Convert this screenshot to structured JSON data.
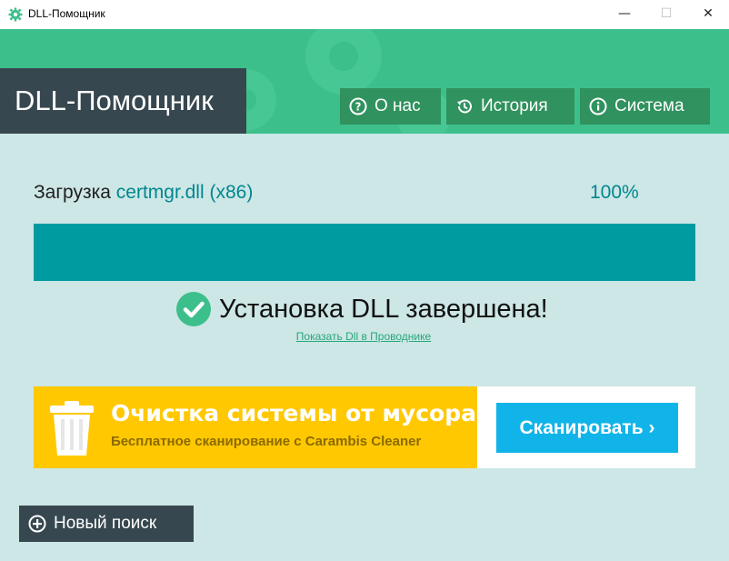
{
  "window": {
    "title": "DLL-Помощник",
    "minimize_glyph": "—",
    "maximize_glyph": "☐",
    "close_glyph": "✕"
  },
  "header": {
    "logo": "DLL-Помощник",
    "nav": [
      {
        "label": "О нас",
        "icon": "question-icon"
      },
      {
        "label": "История",
        "icon": "history-icon"
      },
      {
        "label": "Система",
        "icon": "info-icon"
      }
    ]
  },
  "download": {
    "prefix": "Загрузка",
    "file": "certmgr.dll (x86)",
    "percent_text": "100%",
    "progress": 1.0
  },
  "status": {
    "message": "Установка DLL завершена!",
    "link": "Показать Dll в Проводнике"
  },
  "ad": {
    "title": "Очистка системы от мусора",
    "subtitle": "Бесплатное сканирование с Carambis Cleaner",
    "button": "Сканировать ›"
  },
  "footer": {
    "new_search": "Новый поиск"
  },
  "colors": {
    "header": "#3dbf8c",
    "logo_bg": "#37474f",
    "nav_bg": "#30925e",
    "progress": "#009ba0",
    "accent_text": "#00878f",
    "ad_yellow": "#ffc800",
    "scan_button": "#11b4e9"
  }
}
